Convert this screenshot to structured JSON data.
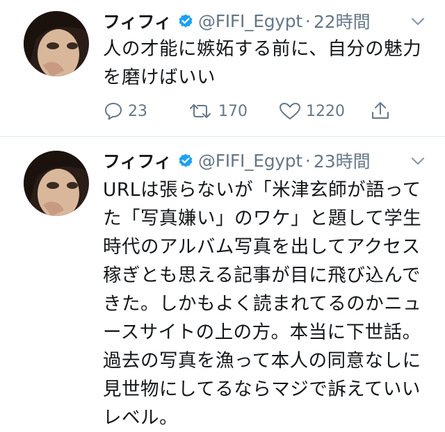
{
  "tweets": [
    {
      "name": "フィフィ",
      "handle": "@FIFI_Egypt",
      "separator": "·",
      "time": "22時間",
      "text": "人の才能に嫉妬する前に、自分の魅力\nを磨けばいい",
      "replies": "23",
      "retweets": "170",
      "likes": "1220"
    },
    {
      "name": "フィフィ",
      "handle": "@FIFI_Egypt",
      "separator": "·",
      "time": "23時間",
      "text": "URLは張らないが「米津玄師が語って\nた「写真嫌い」のワケ」と題して学生\n時代のアルバム写真を出してアクセス\n稼ぎとも思える記事が目に飛び込んで\nきた。しかもよく読まれてるのかニュ\nースサイトの上の方。本当に下世話。\n過去の写真を漁って本人の同意なしに\n見世物にしてるならマジで訴えていい\nレベル。"
    }
  ],
  "colors": {
    "verified": "#1da1f2",
    "muted": "#657786",
    "text": "#14171a"
  },
  "icons": [
    "verified-badge-icon",
    "chevron-down-icon",
    "reply-icon",
    "retweet-icon",
    "like-icon",
    "share-icon"
  ]
}
